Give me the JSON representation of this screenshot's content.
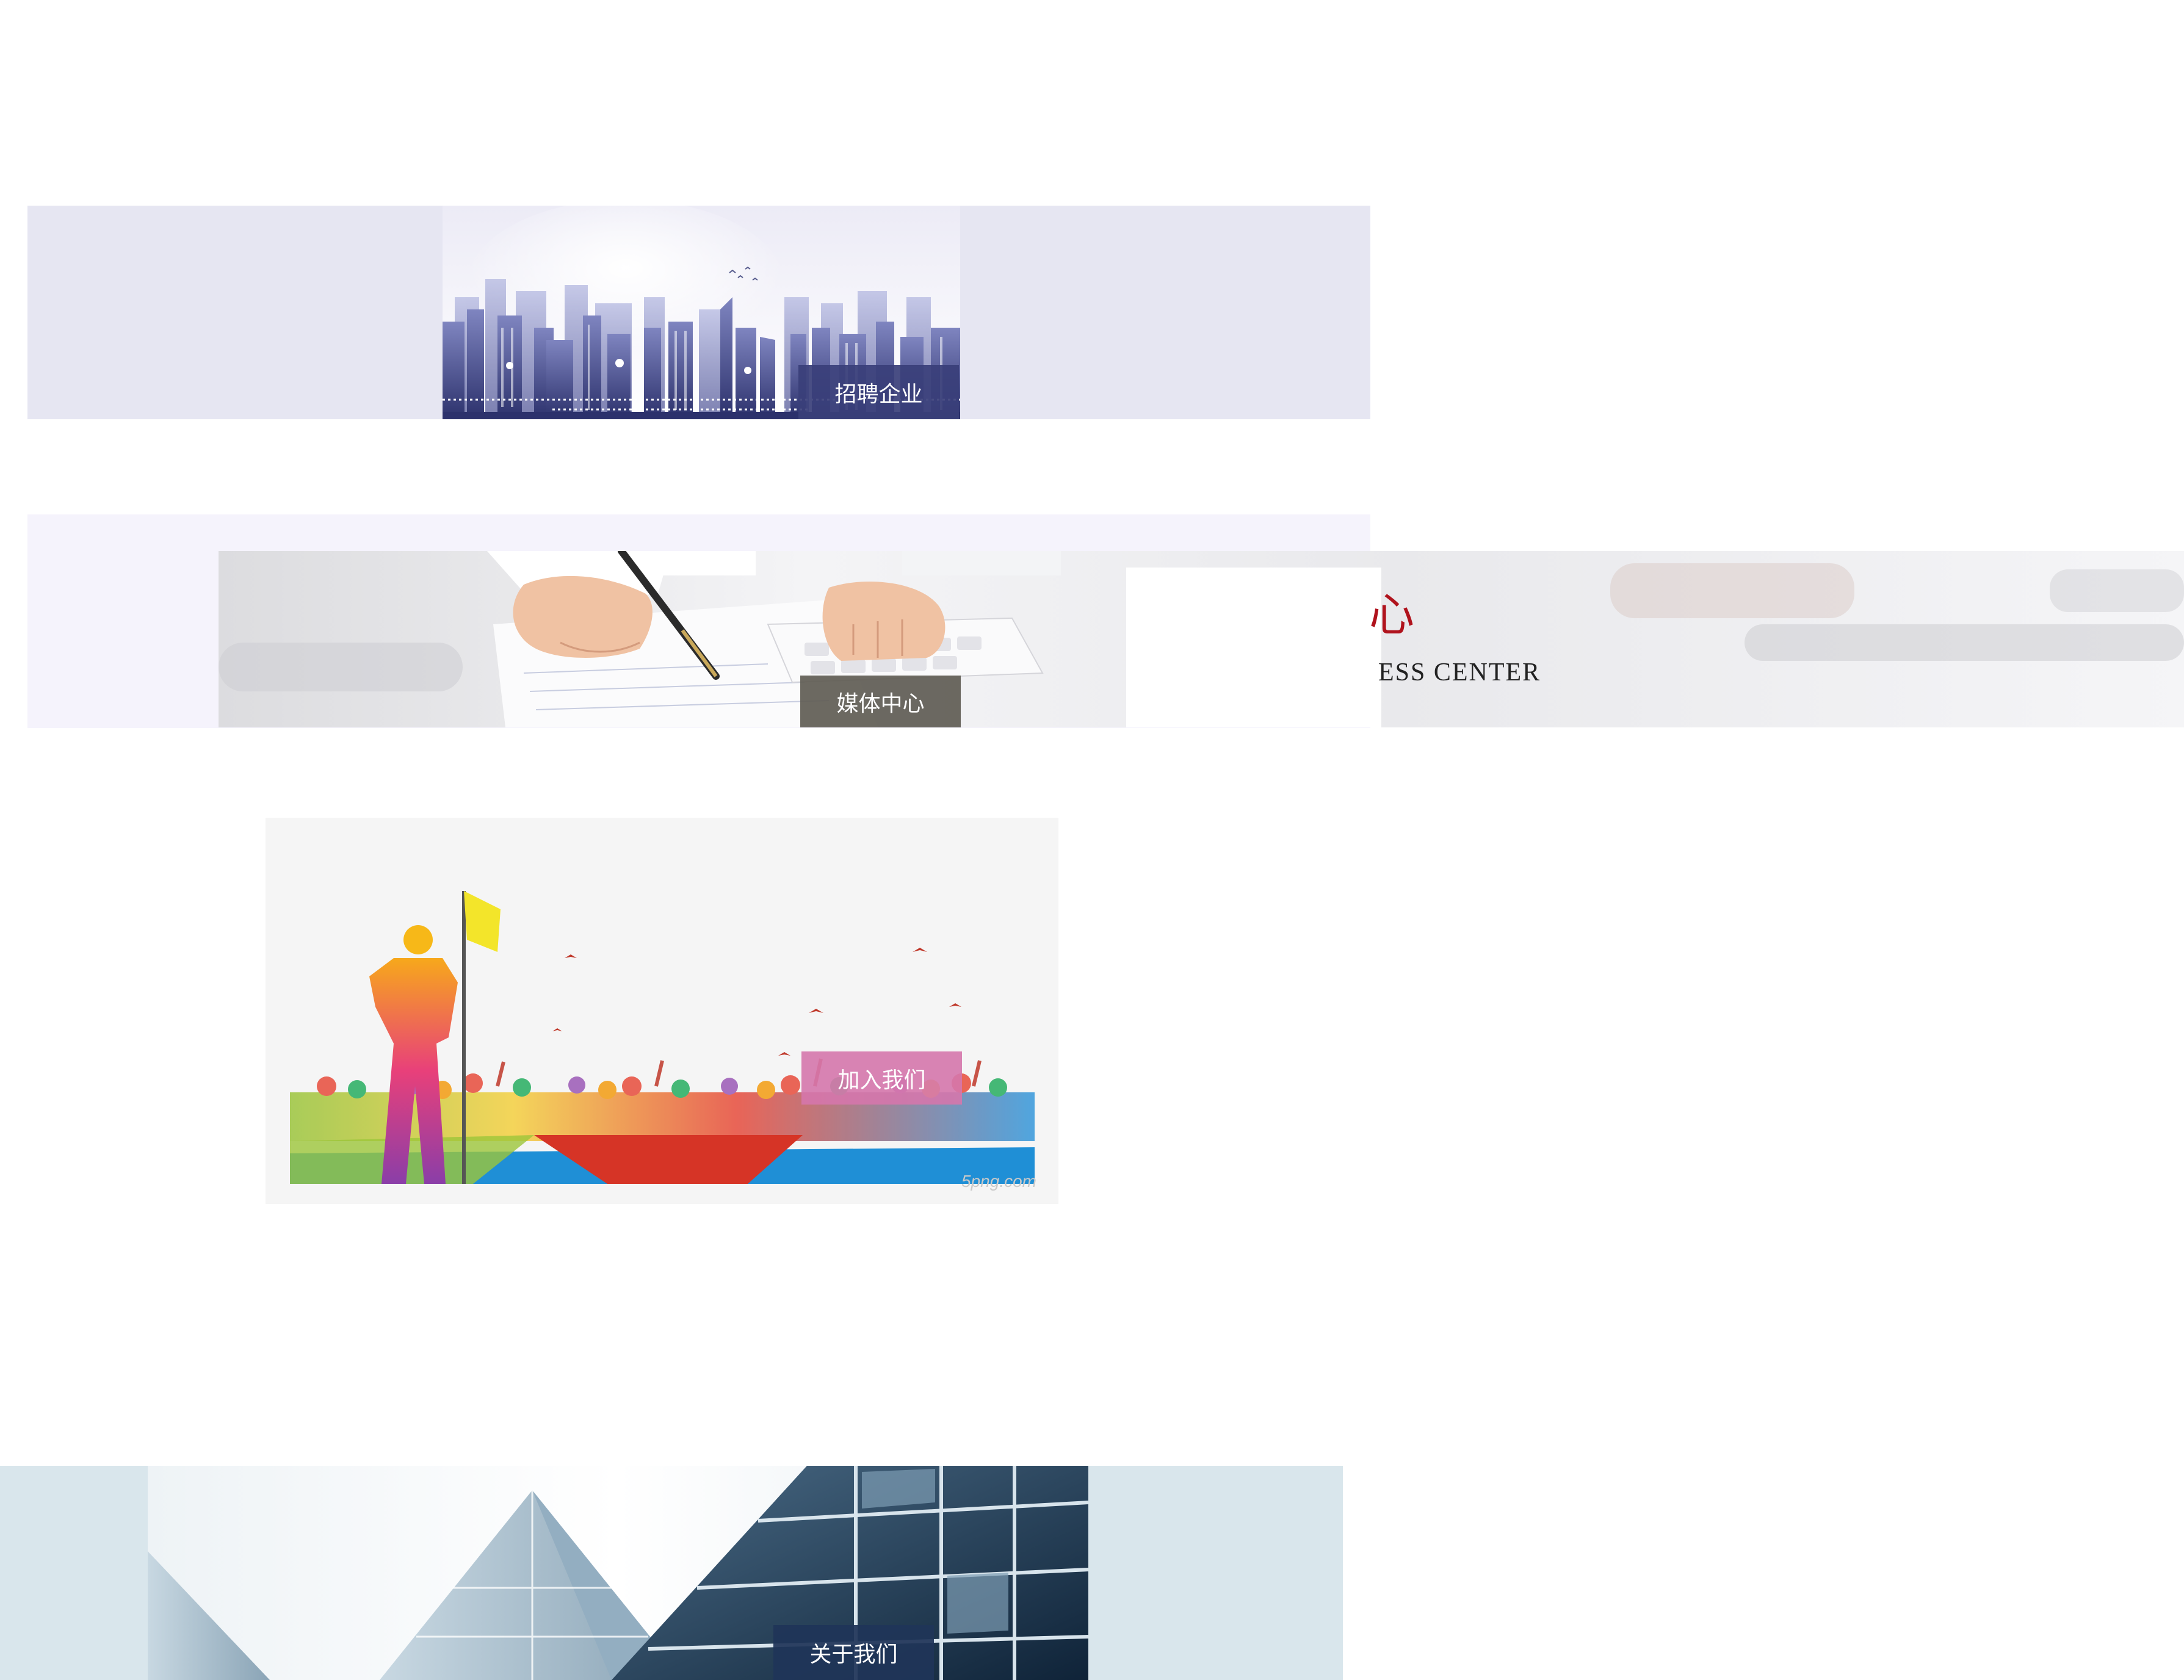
{
  "banners": {
    "recruit": {
      "label": "招聘企业"
    },
    "media": {
      "label": "媒体中心",
      "overlay_text": "ESS CENTER",
      "overlay_red": "心"
    },
    "join": {
      "label": "加入我们",
      "watermark": "5png.com"
    },
    "about": {
      "label": "关于我们"
    }
  },
  "colors": {
    "recruit_bg": "#e6e6f2",
    "recruit_label_bg": "#3a3f7a",
    "media_bg": "#f5f3fc",
    "media_label_bg": "#6f6b63",
    "join_bg": "#f5f5f5",
    "join_label_bg": "#d577ac",
    "about_bg": "#d9e6ec",
    "about_label_bg": "#1f3558"
  }
}
